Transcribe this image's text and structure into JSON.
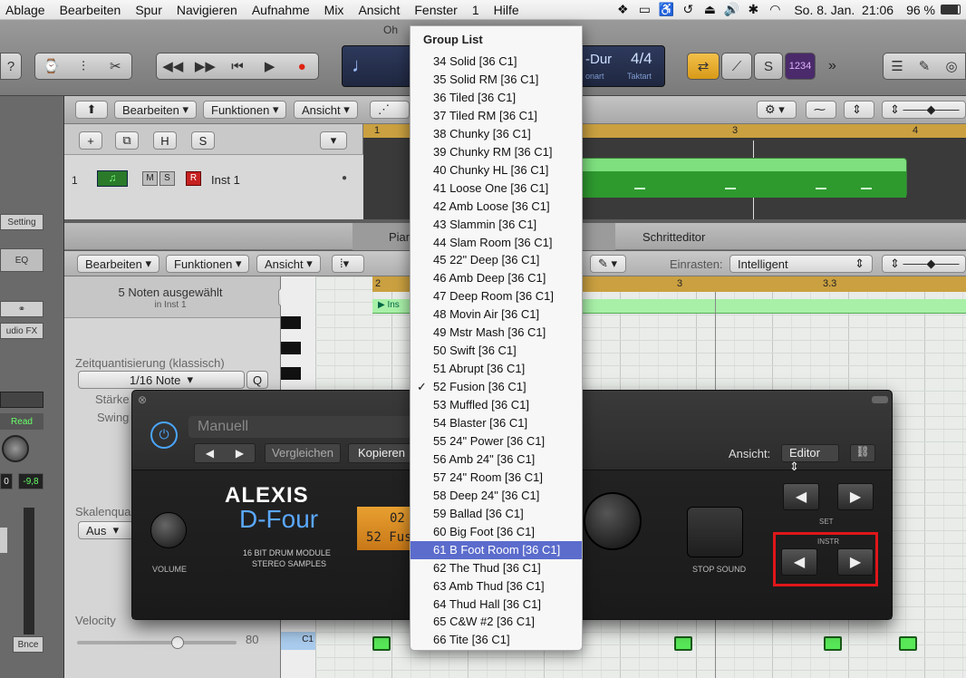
{
  "menubar": {
    "items": [
      "Ablage",
      "Bearbeiten",
      "Spur",
      "Navigieren",
      "Aufnahme",
      "Mix",
      "Ansicht",
      "Fenster",
      "1",
      "Hilfe"
    ],
    "datetime": "So. 8. Jan.  21:06",
    "battery": "96 %",
    "icons": [
      "dropbox-icon",
      "screen-icon",
      "accessibility-icon",
      "time-machine-icon",
      "eject-icon",
      "volume-icon",
      "bluetooth-icon",
      "wifi-icon"
    ]
  },
  "controlbar": {
    "lcd": {
      "key": "-Dur",
      "key_label": "onart",
      "time_sig": "4/4",
      "time_sig_label": "Taktart",
      "key_prefix": "Oh"
    },
    "counter": "1234"
  },
  "tracks": {
    "toolbar": [
      "Bearbeiten",
      "Funktionen",
      "Ansicht"
    ],
    "header_buttons": [
      "+",
      "",
      "H",
      "S"
    ],
    "track": {
      "number": "1",
      "m": "M",
      "s": "S",
      "r": "R",
      "name": "Inst 1"
    },
    "ruler": [
      "1",
      "3",
      "4"
    ]
  },
  "inspector": {
    "setting": "Setting",
    "eq": "EQ",
    "audio_fx": "udio FX",
    "read": "Read",
    "val1": "0",
    "val2": "-9,8",
    "bnce": "Bnce"
  },
  "pianoroll": {
    "tabs": [
      "Pian",
      "Schritteditor"
    ],
    "toolbar": [
      "Bearbeiten",
      "Funktionen",
      "Ansicht"
    ],
    "snap_label": "Einrasten:",
    "snap_value": "Intelligent",
    "selection": "5 Noten ausgewählt",
    "selection_sub": "in Inst 1",
    "quant_label": "Zeitquantisierung (klassisch)",
    "quant_value": "1/16 Note",
    "quant_q": "Q",
    "strength": "Stärke",
    "swing": "Swing",
    "scale_label": "Skalenqua",
    "scale_value": "Aus",
    "velocity_label": "Velocity",
    "velocity_value": "80",
    "key_c1": "C1",
    "ruler": [
      "2",
      "3",
      "3.3"
    ],
    "region_label": "Ins"
  },
  "plugin": {
    "preset": "Manuell",
    "compare": "Vergleichen",
    "copy": "Kopieren",
    "view_label": "Ansicht:",
    "view_value": "Editor",
    "brand": "ALEXIS",
    "model": "D-Four",
    "sub1": "16 BIT DRUM MODULE",
    "sub2": "STEREO SAMPLES",
    "volume": "VOLUME",
    "lcd_line1": "02",
    "lcd_line2": "52 Fus",
    "stop_sound": "STOP SOUND",
    "set_label": "SET",
    "instr_label": "INSTR"
  },
  "dropdown": {
    "header": "Group List",
    "checked": "52 Fusion [36 C1]",
    "selected": "61 B Foot Room [36 C1]",
    "items": [
      "34 Solid [36 C1]",
      "35 Solid RM [36 C1]",
      "36 Tiled [36 C1]",
      "37 Tiled RM [36 C1]",
      "38 Chunky [36 C1]",
      "39 Chunky RM [36 C1]",
      "40 Chunky HL [36 C1]",
      "41 Loose One [36 C1]",
      "42 Amb Loose [36 C1]",
      "43 Slammin [36 C1]",
      "44 Slam Room [36 C1]",
      "45 22\" Deep [36 C1]",
      "46 Amb Deep [36 C1]",
      "47 Deep Room [36 C1]",
      "48 Movin Air [36 C1]",
      "49 Mstr Mash [36 C1]",
      "50 Swift [36 C1]",
      "51 Abrupt [36 C1]",
      "52 Fusion [36 C1]",
      "53 Muffled [36 C1]",
      "54 Blaster [36 C1]",
      "55 24\" Power [36 C1]",
      "56 Amb 24\" [36 C1]",
      "57 24\" Room [36 C1]",
      "58 Deep 24\" [36 C1]",
      "59 Ballad [36 C1]",
      "60 Big Foot [36 C1]",
      "61 B Foot Room [36 C1]",
      "62 The Thud [36 C1]",
      "63 Amb Thud [36 C1]",
      "64 Thud Hall [36 C1]",
      "65 C&W #2 [36 C1]",
      "66 Tite [36 C1]"
    ]
  },
  "colors": {
    "selection": "#5b6ccc",
    "highlight_box": "#e0161a",
    "region": "#7ee07e",
    "ruler": "#caa040"
  }
}
